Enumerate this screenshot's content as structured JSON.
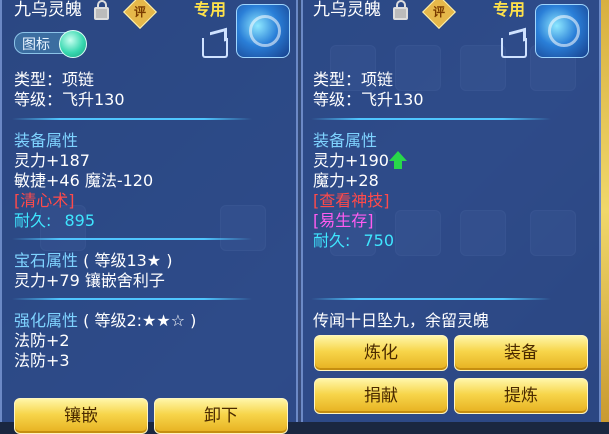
{
  "left": {
    "item_name": "九乌灵魄",
    "exclusive_label": "专用",
    "appraise_badge": "评",
    "icon_toggle_label": "图标",
    "type_line": "类型：项链",
    "level_line": "等级：飞升130",
    "equip_attr_title": "装备属性",
    "attr_lines": [
      "灵力+187",
      "敏捷+46 魔法-120"
    ],
    "special_skill": "[清心术]",
    "durability_label": "耐久:",
    "durability_value": "895",
    "gem_attr_title": "宝石属性",
    "gem_attr_detail": "( 等级13★ )",
    "gem_line": "灵力+79 镶嵌舍利子",
    "strengthen_title": "强化属性",
    "strengthen_detail": "( 等级2:★★☆ )",
    "strengthen_lines": [
      "法防+2",
      "法防+3"
    ],
    "buttons": [
      "镶嵌",
      "卸下"
    ]
  },
  "right": {
    "item_name": "九乌灵魄",
    "exclusive_label": "专用",
    "appraise_badge": "评",
    "type_line": "类型：项链",
    "level_line": "等级：飞升130",
    "equip_attr_title": "装备属性",
    "attr_lines": [
      "灵力+190",
      "魔力+28"
    ],
    "view_skill": "[查看神技]",
    "effect": "[易生存]",
    "durability_label": "耐久:",
    "durability_value": "750",
    "lore_text": "传闻十日坠九，余留灵魄",
    "buttons": [
      "炼化",
      "装备",
      "捐献",
      "提炼"
    ]
  },
  "colors": {
    "section_title": "#7fd3ff",
    "skill_red": "#ff4a4a",
    "durability_cyan": "#3fe6ff",
    "effect_pink": "#ff5cf0",
    "button_gold": "#f7d54a",
    "upgrade_arrow": "#28d84a"
  }
}
